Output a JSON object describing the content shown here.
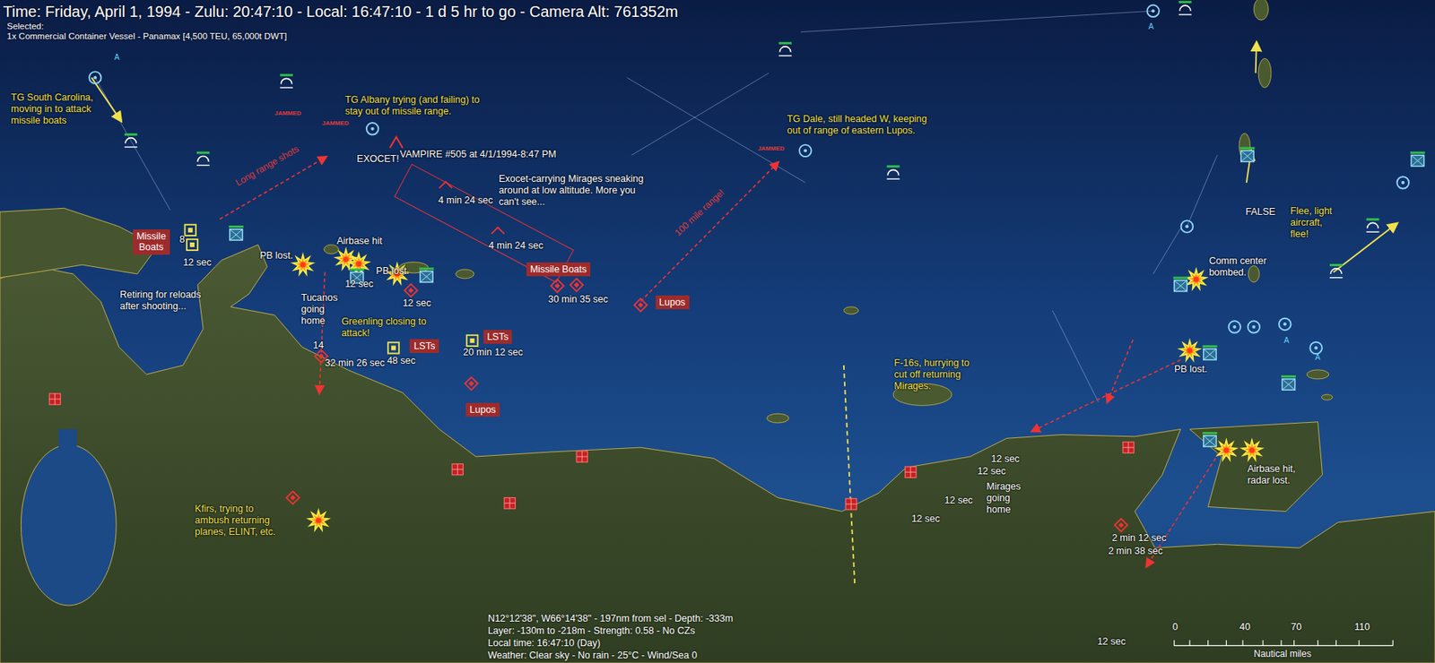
{
  "header": {
    "time": "Time: Friday, April 1, 1994 - Zulu: 20:47:10 - Local: 16:47:10 - 1 d 5 hr to go -  Camera Alt: 761352m",
    "selected_label": "Selected:",
    "selected_unit": "1x Commercial Container Vessel - Panamax [4,500 TEU, 65,000t DWT]"
  },
  "annotations": [
    {
      "text": "TG South Carolina,\nmoving in to attack\nmissile boats",
      "color": "#f2e14c"
    },
    {
      "text": "TG Albany trying (and failing) to\nstay out of missile range.",
      "color": "#f2e14c"
    },
    {
      "text": "TG Dale, still headed W, keeping\nout of range of eastern Lupos.",
      "color": "#f2e14c"
    },
    {
      "text": "Greenling closing to\nattack!",
      "color": "#f2e14c"
    },
    {
      "text": "Kfirs, trying to\nambush returning\nplanes, ELINT, etc.",
      "color": "#f2e14c"
    },
    {
      "text": "F-16s, hurrying to\ncut off returning\nMirages.",
      "color": "#f2e14c"
    },
    {
      "text": "Flee, light\naircraft,\nflee!",
      "color": "#f2e14c"
    },
    {
      "text": "EXOCET!",
      "color": "#ffffff"
    },
    {
      "text": "VAMPIRE #505 at 4/1/1994-8:47 PM",
      "color": "#ffffff"
    },
    {
      "text": "Exocet-carrying Mirages sneaking\naround at low altitude. More you\ncan't see...",
      "color": "#ffffff"
    },
    {
      "text": "4 min 24 sec",
      "color": "#ffffff"
    },
    {
      "text": "4 min 24 sec",
      "color": "#ffffff"
    },
    {
      "text": "PB lost.",
      "color": "#ffffff"
    },
    {
      "text": "Airbase hit",
      "color": "#ffffff"
    },
    {
      "text": "PB lost.",
      "color": "#ffffff"
    },
    {
      "text": "Tucanos\ngoing\nhome",
      "color": "#ffffff"
    },
    {
      "text": "Retiring for reloads\nafter shooting...",
      "color": "#ffffff"
    },
    {
      "text": "12 sec",
      "color": "#ffffff"
    },
    {
      "text": "12 sec",
      "color": "#ffffff"
    },
    {
      "text": "12 sec",
      "color": "#ffffff"
    },
    {
      "text": "8",
      "color": "#ffffff"
    },
    {
      "text": "14",
      "color": "#ffffff"
    },
    {
      "text": "32 min 26 sec",
      "color": "#ffffff"
    },
    {
      "text": "48 sec",
      "color": "#ffffff"
    },
    {
      "text": "30 min 35 sec",
      "color": "#ffffff"
    },
    {
      "text": "20 min 12 sec",
      "color": "#ffffff"
    },
    {
      "text": "Comm center\nbombed.",
      "color": "#ffffff"
    },
    {
      "text": "PB lost.",
      "color": "#ffffff"
    },
    {
      "text": "Airbase hit,\nradar lost.",
      "color": "#ffffff"
    },
    {
      "text": "Mirages\ngoing\nhome",
      "color": "#ffffff"
    },
    {
      "text": "12 sec",
      "color": "#ffffff"
    },
    {
      "text": "12 sec",
      "color": "#ffffff"
    },
    {
      "text": "12 sec",
      "color": "#ffffff"
    },
    {
      "text": "12 sec",
      "color": "#ffffff"
    },
    {
      "text": "2 min 12 sec",
      "color": "#ffffff"
    },
    {
      "text": "2 min 38 sec",
      "color": "#ffffff"
    },
    {
      "text": "12 sec",
      "color": "#ffffff"
    },
    {
      "text": "FALSE",
      "color": "#ffffff"
    }
  ],
  "unit_labels": [
    "Missile\nBoats",
    "Missile Boats",
    "Lupos",
    "LSTs",
    "LSTs",
    "Lupos"
  ],
  "range_labels": [
    "Long range shots",
    "100 mile range!"
  ],
  "jammed_labels": [
    "JAMMED",
    "JAMMED",
    "JAMMED"
  ],
  "side_labels": [
    "A",
    "A",
    "A",
    "A"
  ],
  "markers": [
    {
      "kind": "explosion"
    },
    {
      "kind": "explosion"
    },
    {
      "kind": "explosion"
    },
    {
      "kind": "explosion"
    },
    {
      "kind": "explosion"
    },
    {
      "kind": "explosion"
    },
    {
      "kind": "explosion"
    },
    {
      "kind": "explosion"
    },
    {
      "kind": "explosion"
    },
    {
      "kind": "hostile"
    },
    {
      "kind": "hostile"
    },
    {
      "kind": "hostile"
    },
    {
      "kind": "hostile"
    },
    {
      "kind": "hostile"
    },
    {
      "kind": "hostile"
    },
    {
      "kind": "hostile"
    },
    {
      "kind": "hostile"
    },
    {
      "kind": "facility"
    },
    {
      "kind": "facility"
    },
    {
      "kind": "facility"
    },
    {
      "kind": "facility"
    },
    {
      "kind": "facility"
    },
    {
      "kind": "facility"
    },
    {
      "kind": "facility"
    },
    {
      "kind": "friendly"
    },
    {
      "kind": "friendly"
    },
    {
      "kind": "friendly"
    },
    {
      "kind": "friendly"
    },
    {
      "kind": "ship"
    },
    {
      "kind": "ship"
    },
    {
      "kind": "ship"
    },
    {
      "kind": "ship"
    },
    {
      "kind": "ship"
    },
    {
      "kind": "ship"
    },
    {
      "kind": "ship"
    },
    {
      "kind": "ship"
    },
    {
      "kind": "ship"
    },
    {
      "kind": "aircraft"
    },
    {
      "kind": "aircraft"
    },
    {
      "kind": "aircraft"
    },
    {
      "kind": "aircraft"
    },
    {
      "kind": "aircraft"
    },
    {
      "kind": "aircraft"
    },
    {
      "kind": "aircraft"
    },
    {
      "kind": "aircraft"
    },
    {
      "kind": "aircraft"
    },
    {
      "kind": "aircraft"
    },
    {
      "kind": "contact"
    },
    {
      "kind": "contact"
    },
    {
      "kind": "contact"
    },
    {
      "kind": "contact"
    },
    {
      "kind": "contact"
    },
    {
      "kind": "contact"
    },
    {
      "kind": "contact"
    },
    {
      "kind": "contact"
    }
  ],
  "cursor_info": [
    "N12°12'38\", W66°14'38\" - 197nm from sel - Depth: -333m",
    "Layer: -130m to -218m - Strength: 0.58 - No CZs",
    "Local time: 16:47:10 (Day)",
    "Weather: Clear sky - No rain - 25°C - Wind/Sea 0"
  ],
  "scale": {
    "ticks": [
      "0",
      "40",
      "70",
      "110"
    ],
    "unit": "Nautical miles"
  }
}
